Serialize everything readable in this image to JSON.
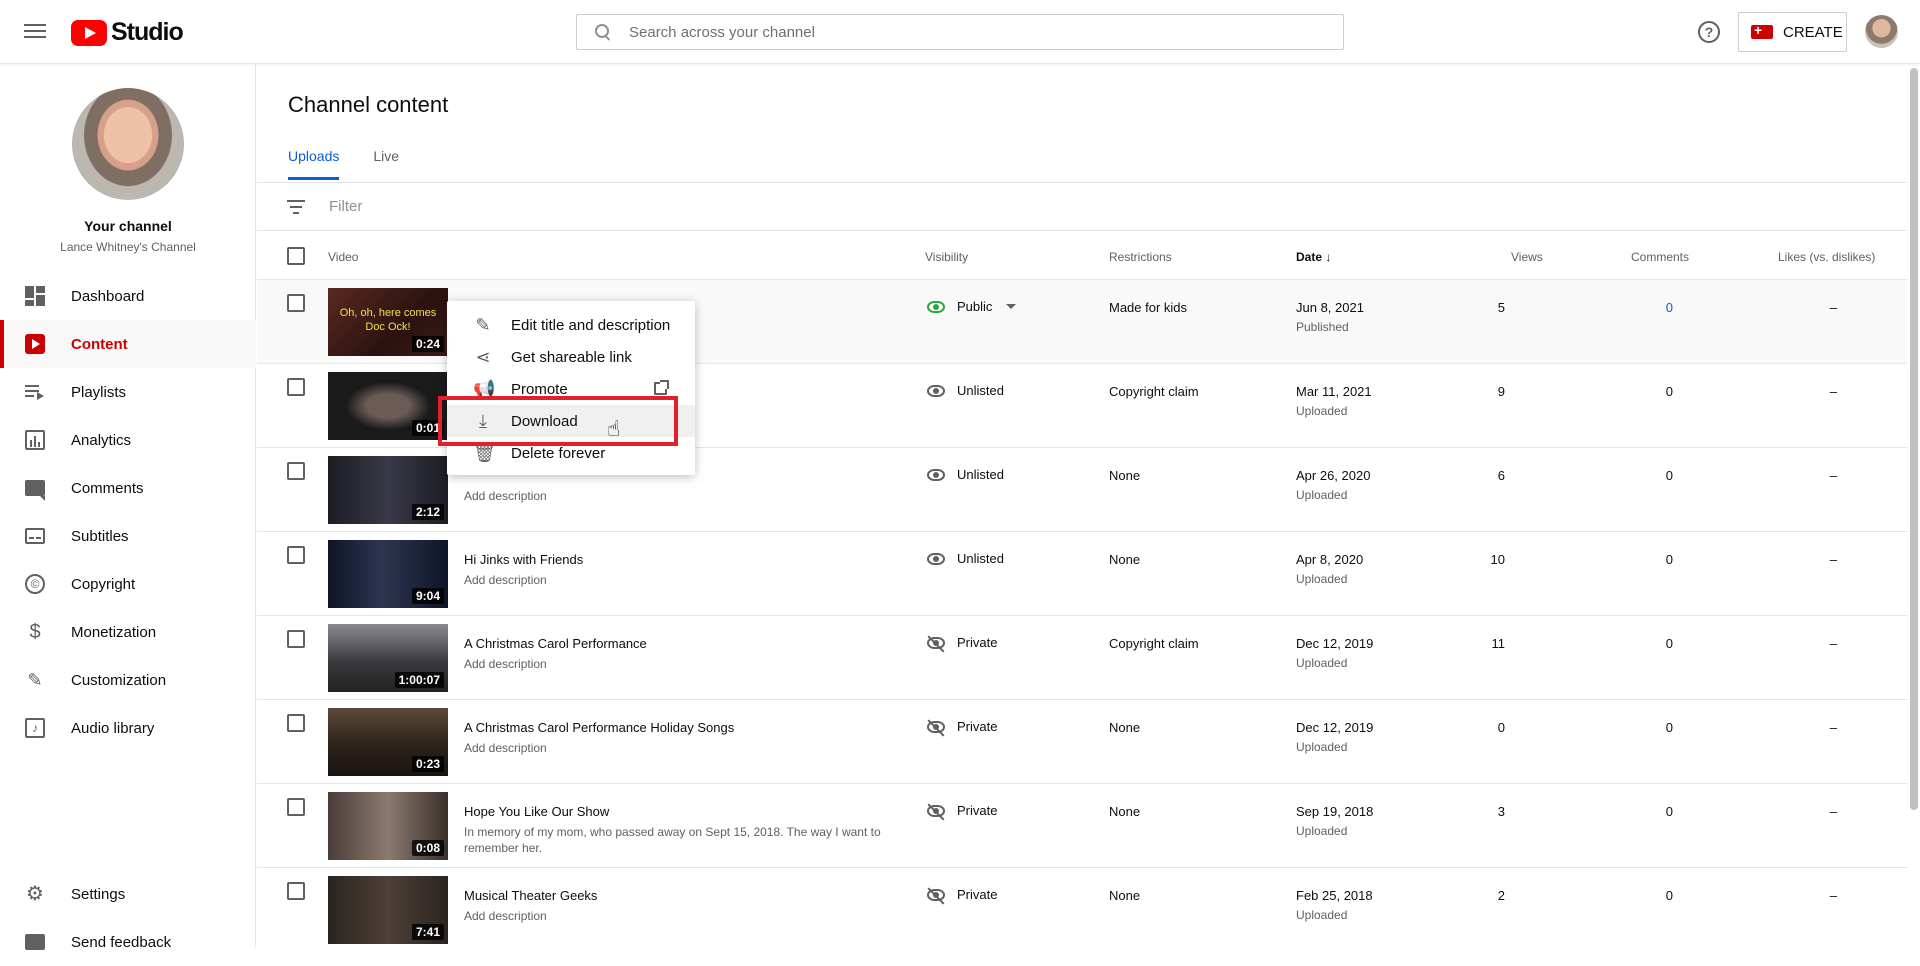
{
  "header": {
    "logo_text": "Studio",
    "search_placeholder": "Search across your channel",
    "help_label": "?",
    "create_label": "CREATE"
  },
  "sidebar": {
    "channel_label": "Your channel",
    "channel_name": "Lance Whitney's Channel",
    "items": [
      {
        "label": "Dashboard",
        "icon": "dashboard-icon"
      },
      {
        "label": "Content",
        "icon": "content-icon",
        "active": true
      },
      {
        "label": "Playlists",
        "icon": "playlists-icon"
      },
      {
        "label": "Analytics",
        "icon": "analytics-icon"
      },
      {
        "label": "Comments",
        "icon": "comments-icon"
      },
      {
        "label": "Subtitles",
        "icon": "subtitles-icon"
      },
      {
        "label": "Copyright",
        "icon": "copyright-icon"
      },
      {
        "label": "Monetization",
        "icon": "monetization-icon"
      },
      {
        "label": "Customization",
        "icon": "customization-icon"
      },
      {
        "label": "Audio library",
        "icon": "audio-library-icon"
      }
    ],
    "bottom": [
      {
        "label": "Settings",
        "icon": "gear-icon"
      },
      {
        "label": "Send feedback",
        "icon": "feedback-icon"
      }
    ]
  },
  "main": {
    "title": "Channel content",
    "tabs": [
      {
        "label": "Uploads",
        "active": true
      },
      {
        "label": "Live"
      }
    ],
    "filter_placeholder": "Filter",
    "columns": {
      "video": "Video",
      "visibility": "Visibility",
      "restrictions": "Restrictions",
      "date": "Date",
      "date_sort_icon": "↓",
      "views": "Views",
      "comments": "Comments",
      "likes": "Likes (vs. dislikes)"
    },
    "rows": [
      {
        "title": "",
        "desc": "",
        "duration": "0:24",
        "thumb_text": "Oh, oh, here comes Doc Ock!",
        "visibility": "Public",
        "restrictions": "Made for kids",
        "date": "Jun 8, 2021",
        "status": "Published",
        "views": "5",
        "comments": "0",
        "likes": "–"
      },
      {
        "title": "",
        "desc": "",
        "duration": "0:01",
        "visibility": "Unlisted",
        "restrictions": "Copyright claim",
        "date": "Mar 11, 2021",
        "status": "Uploaded",
        "views": "9",
        "comments": "0",
        "likes": "–"
      },
      {
        "title": "",
        "desc": "Add description",
        "duration": "2:12",
        "visibility": "Unlisted",
        "restrictions": "None",
        "date": "Apr 26, 2020",
        "status": "Uploaded",
        "views": "6",
        "comments": "0",
        "likes": "–"
      },
      {
        "title": "Hi Jinks with Friends",
        "desc": "Add description",
        "duration": "9:04",
        "visibility": "Unlisted",
        "restrictions": "None",
        "date": "Apr 8, 2020",
        "status": "Uploaded",
        "views": "10",
        "comments": "0",
        "likes": "–"
      },
      {
        "title": "A Christmas Carol Performance",
        "desc": "Add description",
        "duration": "1:00:07",
        "visibility": "Private",
        "restrictions": "Copyright claim",
        "date": "Dec 12, 2019",
        "status": "Uploaded",
        "views": "11",
        "comments": "0",
        "likes": "–"
      },
      {
        "title": "A Christmas Carol Performance Holiday Songs",
        "desc": "Add description",
        "duration": "0:23",
        "visibility": "Private",
        "restrictions": "None",
        "date": "Dec 12, 2019",
        "status": "Uploaded",
        "views": "0",
        "comments": "0",
        "likes": "–"
      },
      {
        "title": "Hope You Like Our Show",
        "desc": "In memory of my mom, who passed away on Sept 15, 2018. The way I want to remember her.",
        "duration": "0:08",
        "visibility": "Private",
        "restrictions": "None",
        "date": "Sep 19, 2018",
        "status": "Uploaded",
        "views": "3",
        "comments": "0",
        "likes": "–"
      },
      {
        "title": "Musical Theater Geeks",
        "desc": "Add description",
        "duration": "7:41",
        "visibility": "Private",
        "restrictions": "None",
        "date": "Feb 25, 2018",
        "status": "Uploaded",
        "views": "2",
        "comments": "0",
        "likes": "–"
      }
    ]
  },
  "context_menu": {
    "items": [
      {
        "label": "Edit title and description",
        "icon": "pencil-icon"
      },
      {
        "label": "Get shareable link",
        "icon": "share-icon"
      },
      {
        "label": "Promote",
        "icon": "megaphone-icon"
      },
      {
        "label": "Download",
        "icon": "download-icon"
      },
      {
        "label": "Delete forever",
        "icon": "trash-icon"
      }
    ]
  },
  "colors": {
    "brand_red": "#ff0000",
    "active_red": "#cc0000",
    "link_blue": "#065fd4",
    "public_green": "#2ba640",
    "highlight_box": "#e0202a"
  }
}
